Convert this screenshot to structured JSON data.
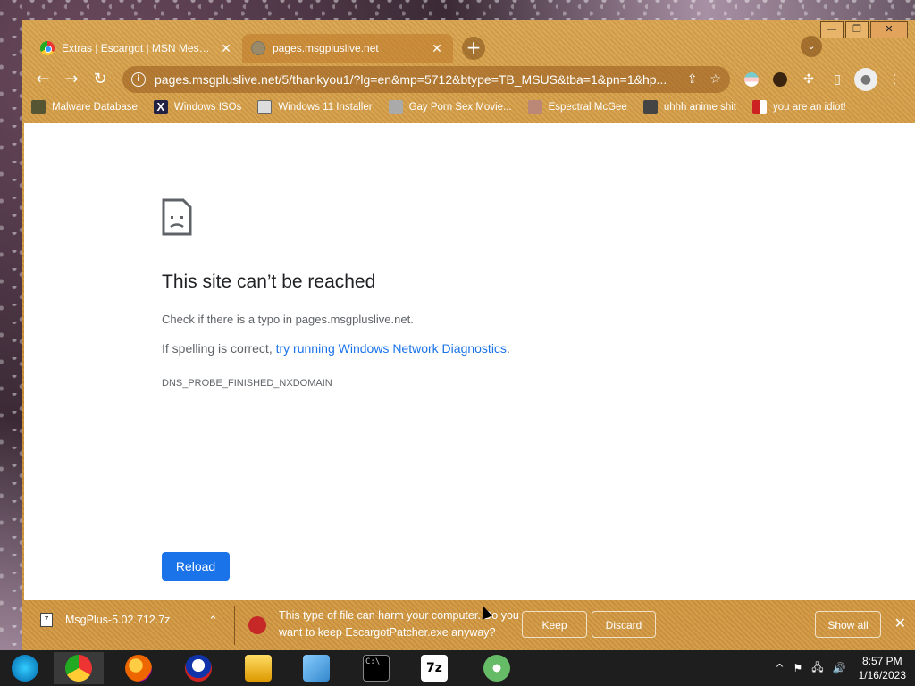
{
  "window": {
    "controls": {
      "minimize": "—",
      "maximize": "❐",
      "close": "✕"
    }
  },
  "tabs": [
    {
      "title": "Extras | Escargot | MSN Messen",
      "close": "✕"
    },
    {
      "title": "pages.msgpluslive.net",
      "close": "✕"
    }
  ],
  "newtab_label": "+",
  "tabsearch_label": "⌄",
  "toolbar": {
    "back": "←",
    "forward": "→",
    "reload": "↻",
    "info": "i",
    "url": "pages.msgpluslive.net/5/thankyou1/?lg=en&mp=5712&btype=TB_MSUS&tba=1&pn=1&hp...",
    "share": "⇪",
    "star": "☆",
    "extensions": "✣",
    "sidepanel": "▯",
    "profile": "●",
    "menu": "⋮"
  },
  "bookmarks": [
    {
      "label": "Malware Database",
      "icon": "malware-icon"
    },
    {
      "label": "Windows ISOs",
      "icon": "x-icon"
    },
    {
      "label": "Windows 11 Installer",
      "icon": "installer-icon"
    },
    {
      "label": "Gay Porn Sex Movie...",
      "icon": "gay-icon"
    },
    {
      "label": "Espectral McGee",
      "icon": "espectral-icon"
    },
    {
      "label": "uhhh anime shit",
      "icon": "anime-icon"
    },
    {
      "label": "you are an idiot!",
      "icon": "idiot-icon"
    }
  ],
  "error_page": {
    "title": "This site can’t be reached",
    "line1": "Check if there is a typo in pages.msgpluslive.net.",
    "line2_prefix": "If spelling is correct, ",
    "line2_link": "try running Windows Network Diagnostics",
    "line2_suffix": ".",
    "code": "DNS_PROBE_FINISHED_NXDOMAIN",
    "reload_label": "Reload"
  },
  "download_bar": {
    "filename": "MsgPlus-5.02.712.7z",
    "file_icon": "7",
    "chevron": "⌃",
    "warning": "This type of file can harm your computer. Do you want to keep EscargotPatcher.exe anyway?",
    "keep_label": "Keep",
    "discard_label": "Discard",
    "show_all_label": "Show all",
    "close": "✕"
  },
  "taskbar": {
    "cmd_text": "C:\\_",
    "sevenzip_text": "7z",
    "tray_icons": [
      "^",
      "⚑",
      "🖧",
      "🔊"
    ],
    "time": "8:57 PM",
    "date": "1/16/2023"
  }
}
